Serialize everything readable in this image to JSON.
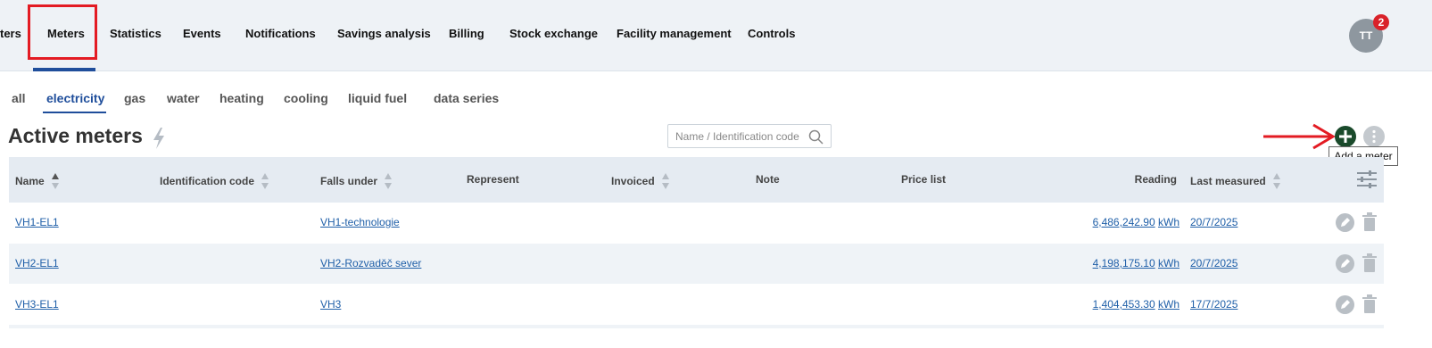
{
  "topnav": {
    "items": [
      "ters",
      "Meters",
      "Statistics",
      "Events",
      "Notifications",
      "Savings analysis",
      "Billing",
      "Stock exchange",
      "Facility management",
      "Controls"
    ],
    "active": "Meters",
    "avatar_initials": "TT",
    "notification_count": "2"
  },
  "subtabs": {
    "items": [
      "all",
      "electricity",
      "gas",
      "water",
      "heating",
      "cooling",
      "liquid fuel",
      "data series"
    ],
    "active": "electricity"
  },
  "page": {
    "title": "Active meters",
    "title_icon": "lightning-bolt-icon"
  },
  "search": {
    "placeholder": "Name / Identification code",
    "value": ""
  },
  "actions": {
    "add_icon": "plus-circle-icon",
    "more_icon": "vertical-dots-icon",
    "add_tooltip": "Add a meter"
  },
  "table": {
    "columns": {
      "name": "Name",
      "identification_code": "Identification code",
      "falls_under": "Falls under",
      "represent": "Represent",
      "invoiced": "Invoiced",
      "note": "Note",
      "price_list": "Price list",
      "reading": "Reading",
      "last_measured": "Last measured"
    },
    "sorted_by": "Name",
    "sort_direction": "ascending",
    "rows": [
      {
        "name": "VH1-EL1",
        "identification_code": "",
        "falls_under": "VH1-technologie",
        "represent": "",
        "invoiced": "",
        "note": "",
        "price_list": "",
        "reading": "6,486,242.90",
        "unit": "kWh",
        "last_measured": "20/7/2025"
      },
      {
        "name": "VH2-EL1",
        "identification_code": "",
        "falls_under": "VH2-Rozvaděč sever",
        "represent": "",
        "invoiced": "",
        "note": "",
        "price_list": "",
        "reading": "4,198,175.10",
        "unit": "kWh",
        "last_measured": "20/7/2025"
      },
      {
        "name": "VH3-EL1",
        "identification_code": "",
        "falls_under": "VH3",
        "represent": "",
        "invoiced": "",
        "note": "",
        "price_list": "",
        "reading": "1,404,453.30",
        "unit": "kWh",
        "last_measured": "17/7/2025"
      }
    ]
  },
  "colors": {
    "accent": "#1f4e9b",
    "link": "#1f5fa8",
    "annotation_red": "#e31b23",
    "add_button": "#1a4a2b",
    "badge": "#d9222a"
  }
}
